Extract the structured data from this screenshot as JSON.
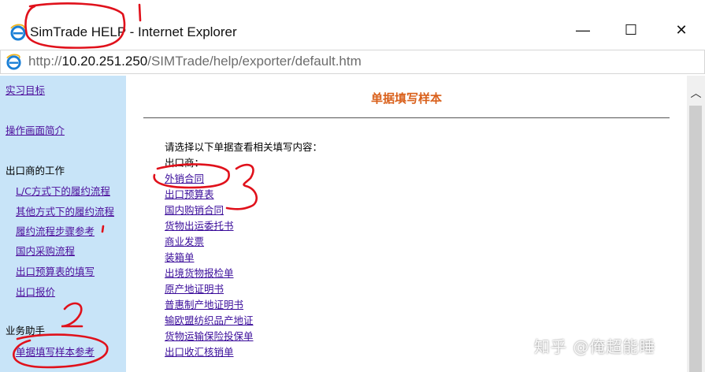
{
  "window": {
    "title": "SimTrade HELP - Internet Explorer",
    "minimize_glyph": "—",
    "maximize_glyph": "☐",
    "close_glyph": "✕"
  },
  "address": {
    "url_prefix": "http://",
    "url_host": "10.20.251.250",
    "url_path": "/SIMTrade/help/exporter/default.htm",
    "icon": "ie-logo-icon"
  },
  "sidebar": {
    "items": [
      {
        "label": "实习目标",
        "type": "link"
      },
      {
        "label": "操作画面简介",
        "type": "link"
      },
      {
        "label": "出口商的工作",
        "type": "head"
      },
      {
        "label": "L/C方式下的履约流程",
        "type": "link"
      },
      {
        "label": "其他方式下的履约流程",
        "type": "link"
      },
      {
        "label": "履约流程步骤参考",
        "type": "link"
      },
      {
        "label": "国内采购流程",
        "type": "link"
      },
      {
        "label": "出口预算表的填写",
        "type": "link"
      },
      {
        "label": "出口报价",
        "type": "link"
      },
      {
        "label": "业务助手",
        "type": "head"
      },
      {
        "label": "单据填写样本参考",
        "type": "link"
      }
    ]
  },
  "content": {
    "title": "单据填写样本",
    "intro": "请选择以下单据查看相关填写内容：",
    "exporter_label": "出口商：",
    "documents": [
      "外销合同",
      "出口预算表",
      "国内购销合同",
      "货物出运委托书",
      "商业发票",
      "装箱单",
      "出境货物报检单",
      "原产地证明书",
      "普惠制产地证明书",
      "输欧盟纺织品产地证",
      "货物运输保险投保单",
      "出口收汇核销单"
    ]
  },
  "watermark": "知乎 @俺超能睡",
  "annotations": {
    "num1": "1",
    "num2": "2",
    "num3": "3",
    "color": "#e0111b"
  },
  "colors": {
    "sidebar_bg": "#c8e4f8",
    "link": "#4d0e9c",
    "title_orange": "#d9601b"
  }
}
